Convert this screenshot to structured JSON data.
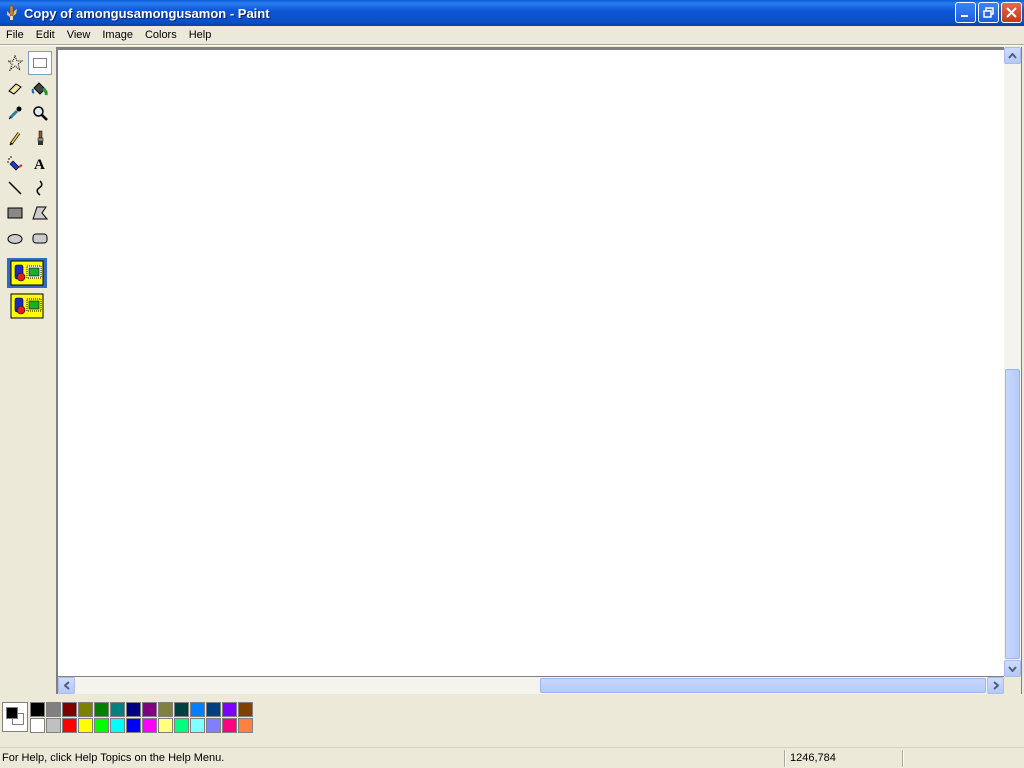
{
  "window": {
    "title": "Copy of amongusamongusamon - Paint"
  },
  "menu": [
    "File",
    "Edit",
    "View",
    "Image",
    "Colors",
    "Help"
  ],
  "tools": [
    {
      "name": "free-form-select-tool",
      "icon": "star-select-icon"
    },
    {
      "name": "rect-select-tool",
      "icon": "rect-select-icon",
      "selected": true
    },
    {
      "name": "eraser-tool",
      "icon": "eraser-icon"
    },
    {
      "name": "fill-tool",
      "icon": "paint-bucket-icon"
    },
    {
      "name": "pick-color-tool",
      "icon": "eyedropper-icon"
    },
    {
      "name": "magnifier-tool",
      "icon": "magnifier-icon"
    },
    {
      "name": "pencil-tool",
      "icon": "pencil-icon"
    },
    {
      "name": "brush-tool",
      "icon": "brush-icon"
    },
    {
      "name": "airbrush-tool",
      "icon": "airbrush-icon"
    },
    {
      "name": "text-tool",
      "icon": "text-a-icon"
    },
    {
      "name": "line-tool",
      "icon": "line-icon"
    },
    {
      "name": "curve-tool",
      "icon": "curve-icon"
    },
    {
      "name": "rectangle-tool",
      "icon": "rectangle-icon"
    },
    {
      "name": "polygon-tool",
      "icon": "polygon-icon"
    },
    {
      "name": "ellipse-tool",
      "icon": "ellipse-icon"
    },
    {
      "name": "rounded-rect-tool",
      "icon": "rounded-rect-icon"
    }
  ],
  "palette": {
    "foreground": "#000000",
    "background": "#ffffff",
    "row1": [
      "#000000",
      "#808080",
      "#800000",
      "#808000",
      "#008000",
      "#008080",
      "#000080",
      "#800080",
      "#808040",
      "#004040",
      "#0080ff",
      "#004080",
      "#8000ff",
      "#804000"
    ],
    "row2": [
      "#ffffff",
      "#c0c0c0",
      "#ff0000",
      "#ffff00",
      "#00ff00",
      "#00ffff",
      "#0000ff",
      "#ff00ff",
      "#ffff80",
      "#00ff80",
      "#80ffff",
      "#8080ff",
      "#ff0080",
      "#ff8040"
    ]
  },
  "status": {
    "help_text": "For Help, click Help Topics on the Help Menu.",
    "coords": "1246,784"
  }
}
